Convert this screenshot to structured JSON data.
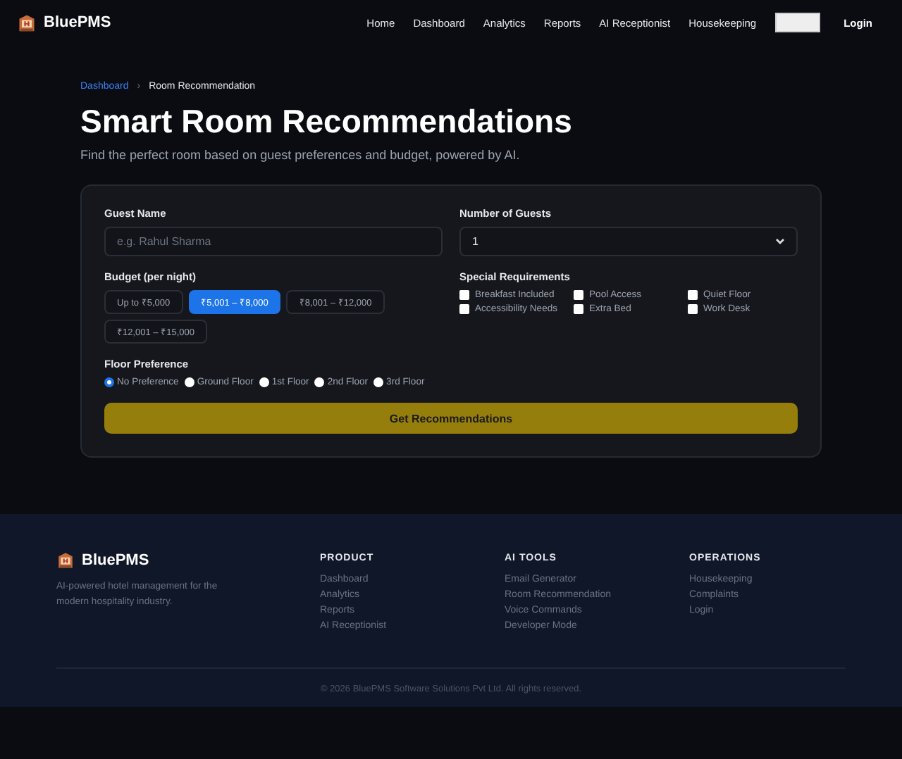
{
  "brand": "BluePMS",
  "nav": [
    {
      "label": "Home",
      "kind": "link"
    },
    {
      "label": "Dashboard",
      "kind": "link"
    },
    {
      "label": "Analytics",
      "kind": "link"
    },
    {
      "label": "Reports",
      "kind": "link"
    },
    {
      "label": "AI Receptionist",
      "kind": "link"
    },
    {
      "label": "Housekeeping",
      "kind": "link"
    },
    {
      "kind": "blank"
    },
    {
      "label": "Login",
      "kind": "login"
    }
  ],
  "breadcrumb": {
    "link": "Dashboard",
    "separator": "›",
    "current": "Room Recommendation"
  },
  "title": "Smart Room Recommendations",
  "subtitle": "Find the perfect room based on guest preferences and budget, powered by AI.",
  "form": {
    "guest_name": {
      "label": "Guest Name",
      "placeholder": "e.g. Rahul Sharma"
    },
    "guests": {
      "label": "Number of Guests",
      "value": "1"
    },
    "budget": {
      "label": "Budget (per night)",
      "options": [
        {
          "label": "Up to ₹5,000",
          "selected": false
        },
        {
          "label": "₹5,001 – ₹8,000",
          "selected": true
        },
        {
          "label": "₹8,001 – ₹12,000",
          "selected": false
        },
        {
          "label": "₹12,001 – ₹15,000",
          "selected": false
        }
      ]
    },
    "requirements": {
      "label": "Special Requirements",
      "items": [
        {
          "label": "Breakfast Included",
          "checked": false
        },
        {
          "label": "Pool Access",
          "checked": false
        },
        {
          "label": "Quiet Floor",
          "checked": false
        },
        {
          "label": "Accessibility Needs",
          "checked": false
        },
        {
          "label": "Extra Bed",
          "checked": false
        },
        {
          "label": "Work Desk",
          "checked": false
        }
      ]
    },
    "floor": {
      "label": "Floor Preference",
      "options": [
        {
          "label": "No Preference",
          "selected": true
        },
        {
          "label": "Ground Floor",
          "selected": false
        },
        {
          "label": "1st Floor",
          "selected": false
        },
        {
          "label": "2nd Floor",
          "selected": false
        },
        {
          "label": "3rd Floor",
          "selected": false
        }
      ]
    },
    "submit": "Get Recommendations"
  },
  "footer": {
    "brand": "BluePMS",
    "tagline": "AI-powered hotel management for the modern hospitality industry.",
    "columns": [
      {
        "heading": "PRODUCT",
        "links": [
          "Dashboard",
          "Analytics",
          "Reports",
          "AI Receptionist"
        ]
      },
      {
        "heading": "AI TOOLS",
        "links": [
          "Email Generator",
          "Room Recommendation",
          "Voice Commands",
          "Developer Mode"
        ]
      },
      {
        "heading": "OPERATIONS",
        "links": [
          "Housekeeping",
          "Complaints",
          "Login"
        ]
      }
    ],
    "copyright": "© 2026 BluePMS Software Solutions Pvt Ltd. All rights reserved."
  }
}
